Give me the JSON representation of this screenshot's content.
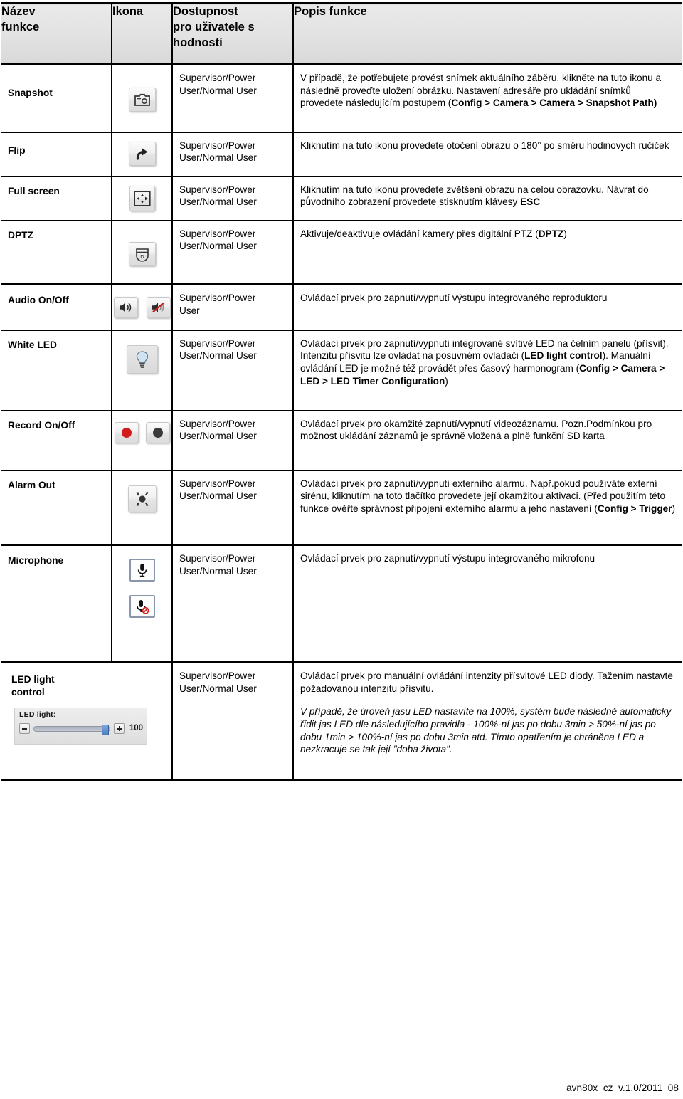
{
  "table": {
    "headers": [
      {
        "label": "Název\nfunkce",
        "line1": "Název",
        "line2": "funkce"
      },
      {
        "label": "Ikona",
        "line1": "Ikona",
        "line2": ""
      },
      {
        "label": "Dostupnost pro uživatele s hodností",
        "line1": "Dostupnost",
        "line2": "pro uživatele s",
        "line3": "hodností"
      },
      {
        "label": "Popis funkce",
        "line1": "Popis funkce",
        "line2": ""
      }
    ],
    "rows": [
      {
        "name": "Snapshot",
        "icons": [
          "snapshot-camera-icon"
        ],
        "availability_line1": "Supervisor/Power",
        "availability_line2": "User/Normal User",
        "description_plain": "V případě, že potřebujete provést snímek aktuálního záběru, klikněte na tuto ikonu a následně proveďte uložení obrázku. Nastavení adresáře pro ukládání snímků provedete následujícím postupem (",
        "description_bold": "Config > Camera > Camera > Snapshot Path)",
        "description_tail": ""
      },
      {
        "name": "Flip",
        "icons": [
          "rotate-clockwise-icon"
        ],
        "availability_line1": "Supervisor/Power",
        "availability_line2": "User/Normal User",
        "description_plain": "Kliknutím na tuto ikonu provedete otočení obrazu o 180° po směru hodinových ručiček",
        "description_bold": "",
        "description_tail": ""
      },
      {
        "name": "Full screen",
        "icons": [
          "fullscreen-expand-icon"
        ],
        "availability_line1": "Supervisor/Power",
        "availability_line2": "User/Normal User",
        "description_plain": "Kliknutím na tuto ikonu provedete zvětšení obrazu na celou obrazovku. Návrat do původního zobrazení  provedete stisknutím klávesy ",
        "description_bold": "ESC",
        "description_tail": ""
      },
      {
        "name": "DPTZ",
        "icons": [
          "dptz-icon"
        ],
        "availability_line1": "Supervisor/Power",
        "availability_line2": "User/Normal User",
        "description_plain": "Aktivuje/deaktivuje ovládání kamery přes digitální PTZ (",
        "description_bold": "DPTZ",
        "description_tail": ")"
      },
      {
        "name": "Audio On/Off",
        "icons": [
          "speaker-on-icon",
          "speaker-mute-icon"
        ],
        "availability_line1": "Supervisor/Power",
        "availability_line2": "User",
        "description_plain": "Ovládací prvek pro zapnutí/vypnutí výstupu integrovaného reproduktoru",
        "description_bold": "",
        "description_tail": ""
      },
      {
        "name": "White LED",
        "icons": [
          "lightbulb-icon"
        ],
        "availability_line1": "Supervisor/Power",
        "availability_line2": "User/Normal User",
        "description_seg": [
          {
            "t": "Ovládací prvek pro zapnutí/vypnutí integrované svítivé LED na čelním panelu (přísvit).  Intenzitu přísvitu lze ovládat na posuvném ovladači (",
            "b": false
          },
          {
            "t": "LED light control",
            "b": true
          },
          {
            "t": "). Manuální ovládání LED je možné též provádět přes časový harmonogram (",
            "b": false
          },
          {
            "t": "Config > Camera > LED > LED Timer Configuration",
            "b": true
          },
          {
            "t": ")",
            "b": false
          }
        ]
      },
      {
        "name": "Record On/Off",
        "icons": [
          "record-on-icon",
          "record-off-icon"
        ],
        "availability_line1": "Supervisor/Power",
        "availability_line2": "User/Normal User",
        "description_plain": "Ovládací prvek pro okamžité zapnutí/vypnutí videozáznamu. Pozn.Podmínkou pro možnost ukládání záznamů je správně vložená a plně funkční SD karta",
        "description_bold": "",
        "description_tail": ""
      },
      {
        "name": "Alarm Out",
        "icons": [
          "alarm-siren-icon"
        ],
        "availability_line1": "Supervisor/Power",
        "availability_line2": "User/Normal User",
        "description_seg": [
          {
            "t": "Ovládací prvek pro zapnutí/vypnutí externího alarmu. Např.pokud používáte externí sirénu, kliknutím na  toto tlačítko provedete její okamžitou aktivaci. (Před použitím této funkce ověřte správnost připojení externího alarmu a jeho nastavení (",
            "b": false
          },
          {
            "t": "Config > Trigger",
            "b": true
          },
          {
            "t": ")",
            "b": false
          }
        ]
      },
      {
        "name": "Microphone",
        "icons": [
          "microphone-on-icon",
          "microphone-mute-icon"
        ],
        "availability_line1": "Supervisor/Power",
        "availability_line2": "User/Normal User",
        "description_plain": "Ovládací prvek pro zapnutí/vypnutí výstupu integrovaného mikrofonu",
        "description_bold": "",
        "description_tail": ""
      },
      {
        "name_line1": "LED light",
        "name_line2": "control",
        "icons": [],
        "availability_line1": "Supervisor/Power",
        "availability_line2": "User/Normal User",
        "description_para1": "Ovládací prvek pro manuální ovládání intenzity přísvitové LED diody. Tažením nastavte požadovanou intenzitu přísvitu.",
        "description_para2_italic": "V případě, že úroveň jasu LED nastavíte na 100%, systém bude následně automaticky řídit jas LED dle následujícího pravidla - 100%-ní jas po dobu 3min > 50%-ní jas po dobu 1min > 100%-ní jas po dobu 3min atd. Tímto opatřením je chráněna LED a nezkracuje se tak její \"doba života\"."
      }
    ]
  },
  "led_widget": {
    "label": "LED light:",
    "value": "100",
    "minus": "−",
    "plus": "+"
  },
  "footer": {
    "text": "avn80x_cz_v.1.0/2011_08"
  },
  "colors": {
    "header_bg": "#e4e4e4",
    "border": "#000000",
    "record_on": "#d21b1b",
    "record_off": "#3a3a3a",
    "led_thumb": "#5a86c9"
  }
}
